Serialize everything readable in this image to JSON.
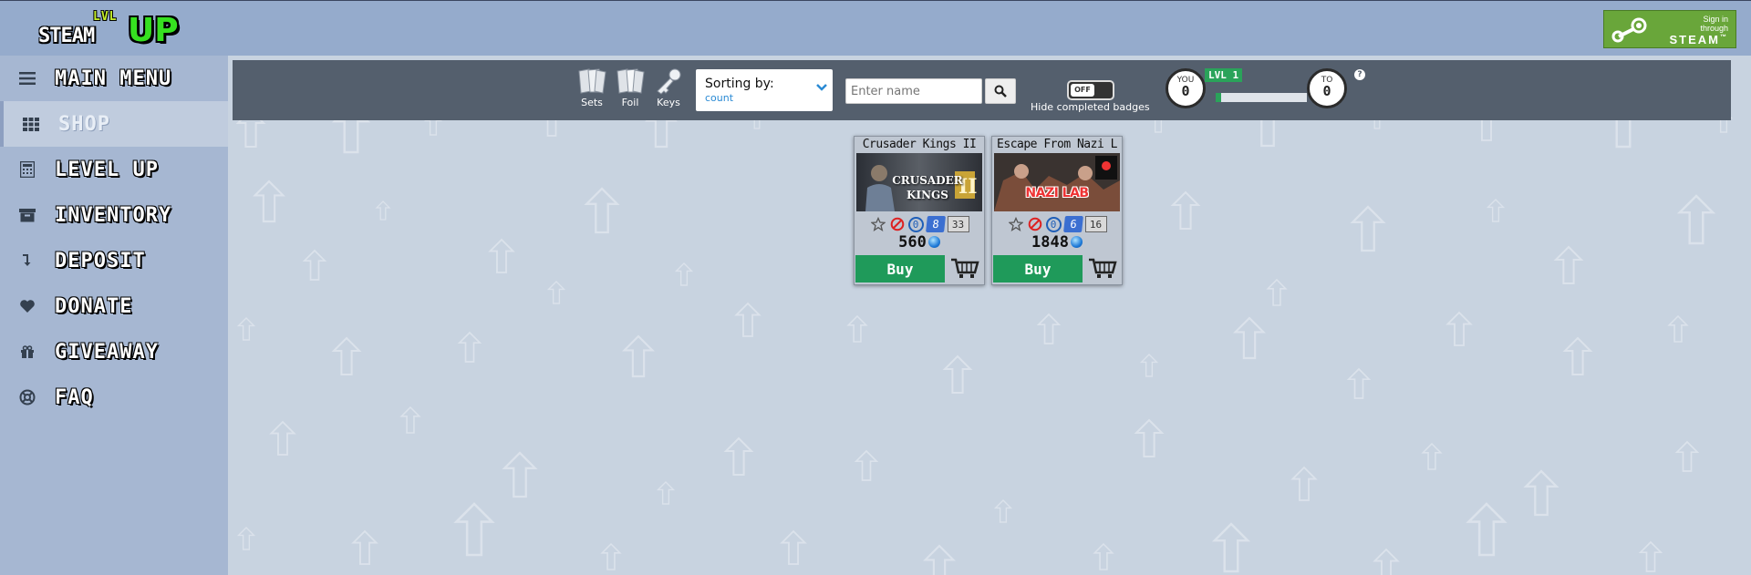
{
  "header": {
    "logo": {
      "lvl": "LVL",
      "steam": "STEAM",
      "up": "UP"
    },
    "signin": {
      "line1": "Sign in",
      "line2": "through",
      "brand": "STEAM",
      "tm": "™"
    }
  },
  "sidebar": {
    "items": [
      {
        "label": "MAIN MENU",
        "icon": "menu-icon",
        "active": false
      },
      {
        "label": "SHOP",
        "icon": "grid-icon",
        "active": true
      },
      {
        "label": "LEVEL UP",
        "icon": "calculator-icon",
        "active": false
      },
      {
        "label": "INVENTORY",
        "icon": "archive-icon",
        "active": false
      },
      {
        "label": "DEPOSIT",
        "icon": "deposit-arrow-icon",
        "active": false
      },
      {
        "label": "DONATE",
        "icon": "heart-icon",
        "active": false
      },
      {
        "label": "GIVEAWAY",
        "icon": "gift-icon",
        "active": false
      },
      {
        "label": "FAQ",
        "icon": "lifebuoy-icon",
        "active": false
      }
    ]
  },
  "toolbar": {
    "filters": [
      {
        "label": "Sets",
        "icon": "cards-sets-icon"
      },
      {
        "label": "Foil",
        "icon": "cards-foil-icon"
      },
      {
        "label": "Keys",
        "icon": "key-icon"
      }
    ],
    "sort": {
      "title": "Sorting by:",
      "value": "count"
    },
    "search": {
      "placeholder": "Enter name"
    },
    "toggle": {
      "state": "OFF",
      "label": "Hide completed badges"
    },
    "level": {
      "you_label": "YOU",
      "you_value": "0",
      "to_label": "TO",
      "to_value": "0",
      "badge": "LVL 1",
      "progress": 0.06,
      "help": "?"
    }
  },
  "games": [
    {
      "title": "Crusader Kings II",
      "banner_text": "CRUSADER KINGS",
      "stats": {
        "owned": "0",
        "cards": "8",
        "total": "33"
      },
      "price": "560",
      "buy_label": "Buy"
    },
    {
      "title": "Escape From Nazi L",
      "banner_text": "NAZI LAB",
      "stats": {
        "owned": "0",
        "cards": "6",
        "total": "16"
      },
      "price": "1848",
      "buy_label": "Buy"
    }
  ],
  "colors": {
    "header_bg": "#95abcc",
    "sidebar_bg": "#a6b7d2",
    "main_bg": "#c8d3e0",
    "toolbar_bg": "#545f6d",
    "accent_green": "#1f9a5a",
    "steam_green": "#69a63a"
  }
}
